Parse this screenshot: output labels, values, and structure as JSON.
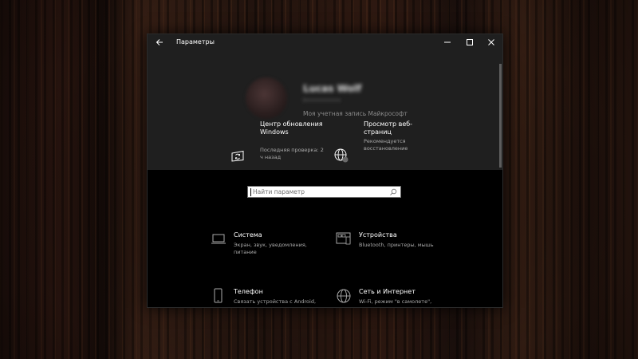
{
  "window": {
    "title": "Параметры"
  },
  "account": {
    "name": "Lucas Wolf",
    "email": "l•••••••••••",
    "link": "Моя учетная запись Майкрософт"
  },
  "tiles": [
    {
      "icon": "windows-update-icon",
      "title": "Центр обновления Windows",
      "subtitle": "Последняя проверка: 2 ч назад"
    },
    {
      "icon": "web-browsing-icon",
      "title": "Просмотр веб-страниц",
      "subtitle": "Рекомендуется восстановление"
    }
  ],
  "search": {
    "placeholder": "Найти параметр"
  },
  "categories": [
    {
      "icon": "laptop-icon",
      "title": "Система",
      "subtitle": "Экран, звук, уведомления, питание"
    },
    {
      "icon": "devices-icon",
      "title": "Устройства",
      "subtitle": "Bluetooth, принтеры, мышь"
    },
    {
      "icon": "phone-icon",
      "title": "Телефон",
      "subtitle": "Связать устройства с Android,"
    },
    {
      "icon": "globe-icon",
      "title": "Сеть и Интернет",
      "subtitle": "Wi-Fi, режим \"в самолете\","
    }
  ]
}
